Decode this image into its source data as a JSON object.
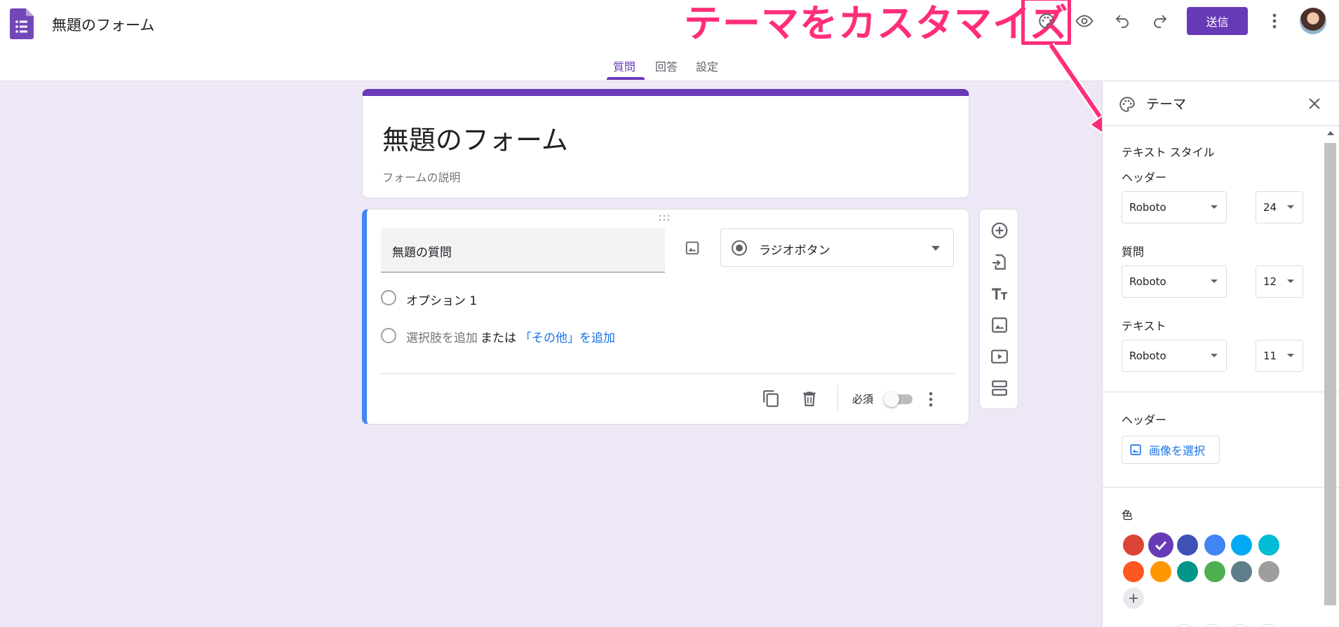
{
  "header": {
    "doc_title": "無題のフォーム",
    "send_label": "送信",
    "tabs": [
      "質問",
      "回答",
      "設定"
    ]
  },
  "annotation": {
    "text": "テーマをカスタマイズ",
    "color": "#ff2d7a"
  },
  "form": {
    "title": "無題のフォーム",
    "description": "フォームの説明",
    "accent": "#673ab7"
  },
  "question": {
    "title": "無題の質問",
    "type_label": "ラジオボタン",
    "option1": "オプション 1",
    "add_option": "選択肢を追加",
    "or_label": "または",
    "add_other": "「その他」を追加",
    "required_label": "必須",
    "required": false
  },
  "theme_panel": {
    "title": "テーマ",
    "text_style_label": "テキスト スタイル",
    "header_label": "ヘッダー",
    "header_font": "Roboto",
    "header_size": "24",
    "question_label": "質問",
    "question_font": "Roboto",
    "question_size": "12",
    "text_label": "テキスト",
    "text_font": "Roboto",
    "text_size": "11",
    "header_image_label": "ヘッダー",
    "choose_image_label": "画像を選択",
    "color_label": "色",
    "colors": [
      "#db4437",
      "#673ab7",
      "#3f51b5",
      "#4285f4",
      "#03a9f4",
      "#00bcd4",
      "#ff5722",
      "#ff9800",
      "#009688",
      "#4caf50",
      "#607d8b",
      "#9e9e9e"
    ],
    "selected_color_index": 1
  },
  "icons": [
    "forms-logo-icon",
    "palette-icon",
    "eye-icon",
    "undo-icon",
    "redo-icon",
    "more-vert-icon",
    "add-circle-icon",
    "import-icon",
    "title-icon",
    "image-icon",
    "video-icon",
    "section-icon",
    "copy-icon",
    "delete-icon",
    "close-icon",
    "radio-button-icon",
    "drag-handle-icon",
    "check-icon",
    "plus-icon"
  ]
}
